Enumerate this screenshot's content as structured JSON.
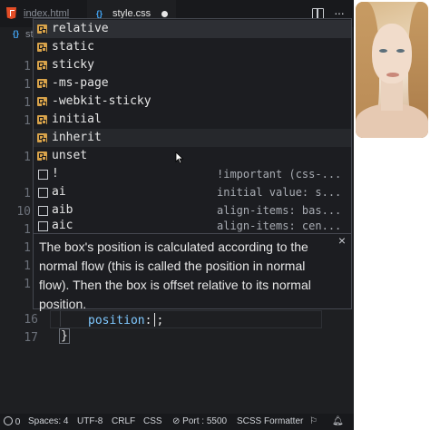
{
  "tabs": [
    {
      "label": "index.html",
      "active": false
    },
    {
      "label": "style.css",
      "active": true,
      "dirty": true
    }
  ],
  "breadcrumb": "st",
  "code_lines": [
    {
      "number": "16",
      "property": "position",
      "colon": ":",
      "semicolon": ";"
    },
    {
      "number": "17",
      "text": "}"
    }
  ],
  "partial_line_numbers": [
    "1",
    "1",
    "1",
    "1",
    "1",
    "1",
    "10",
    "1",
    "1",
    "1",
    "1"
  ],
  "suggestions": [
    {
      "label": "relative",
      "kind": "enum-icon"
    },
    {
      "label": "static",
      "kind": "enum-icon"
    },
    {
      "label": "sticky",
      "kind": "enum-icon"
    },
    {
      "label": "-ms-page",
      "kind": "enum-icon"
    },
    {
      "label": "-webkit-sticky",
      "kind": "enum-icon"
    },
    {
      "label": "initial",
      "kind": "enum-icon"
    },
    {
      "label": "inherit",
      "kind": "enum-icon"
    },
    {
      "label": "unset",
      "kind": "enum-icon"
    },
    {
      "label": "!",
      "kind": "snippet-icon",
      "detail": "!important (css-..."
    },
    {
      "label": "ai",
      "kind": "snippet-icon",
      "detail": "initial value: s..."
    },
    {
      "label": "aib",
      "kind": "snippet-icon",
      "detail": "align-items: bas..."
    },
    {
      "label": "aic",
      "kind": "snippet-icon",
      "detail": "align-items: cen..."
    }
  ],
  "doc": {
    "text": "The box's position is calculated according to the normal flow (this is called the position in normal flow). Then the box is offset relative to its normal position.",
    "close": "×"
  },
  "status": {
    "errors": "0",
    "spaces": "Spaces: 4",
    "encoding": "UTF-8",
    "eol": "CRLF",
    "language": "CSS",
    "port": "Port : 5500",
    "formatter": "SCSS Formatter"
  },
  "colors": {
    "accent": "#42a5f5",
    "enum": "#d7a24a",
    "html": "#e44d26"
  }
}
